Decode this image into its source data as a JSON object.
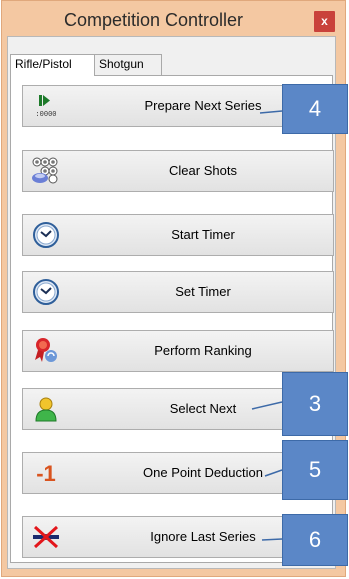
{
  "window": {
    "title": "Competition Controller",
    "close_label": "x"
  },
  "tabs": [
    {
      "label": "Rifle/Pistol",
      "active": true
    },
    {
      "label": "Shotgun",
      "active": false
    }
  ],
  "buttons": [
    {
      "label": "Prepare Next Series",
      "icon": "prepare-next-series-icon"
    },
    {
      "label": "Clear Shots",
      "icon": "clear-shots-icon"
    },
    {
      "label": "Start Timer",
      "icon": "clock-icon"
    },
    {
      "label": "Set Timer",
      "icon": "clock-icon"
    },
    {
      "label": "Perform Ranking",
      "icon": "ranking-icon"
    },
    {
      "label": "Select Next",
      "icon": "person-icon"
    },
    {
      "label": "One Point Deduction",
      "icon": "minus-one-icon",
      "icon_text": "-1"
    },
    {
      "label": "Ignore Last Series",
      "icon": "ignore-series-icon"
    }
  ],
  "prepare_icon_text": ":0000",
  "callouts": [
    "4",
    "3",
    "5",
    "6"
  ],
  "colors": {
    "accent": "#5b87c7",
    "window_border": "#f4c8a2",
    "close": "#c9423b"
  }
}
